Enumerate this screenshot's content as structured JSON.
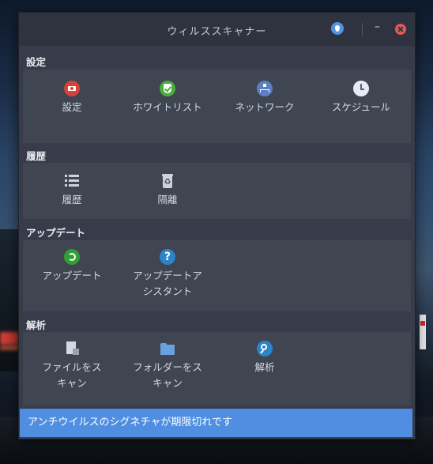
{
  "window": {
    "title": "ウィルススキャナー"
  },
  "sections": {
    "settings": {
      "header": "設定",
      "items": [
        {
          "label": "設定",
          "icon": "settings-icon"
        },
        {
          "label": "ホワイトリスト",
          "icon": "shield-check-icon"
        },
        {
          "label": "ネットワーク",
          "icon": "network-icon"
        },
        {
          "label": "スケジュール",
          "icon": "clock-icon"
        }
      ]
    },
    "history": {
      "header": "履歴",
      "items": [
        {
          "label": "履歴",
          "icon": "list-icon"
        },
        {
          "label": "隔離",
          "icon": "trash-recycle-icon"
        }
      ]
    },
    "update": {
      "header": "アップデート",
      "items": [
        {
          "label": "アップデート",
          "icon": "update-icon",
          "lines": [
            "アップデート"
          ]
        },
        {
          "label": "アップデートアシスタント",
          "icon": "help-icon",
          "lines": [
            "アップデートア",
            "シスタント"
          ]
        }
      ]
    },
    "analysis": {
      "header": "解析",
      "items": [
        {
          "label": "ファイルをスキャン",
          "icon": "file-icon",
          "lines": [
            "ファイルをス",
            "キャン"
          ]
        },
        {
          "label": "フォルダーをスキャン",
          "icon": "folder-icon",
          "lines": [
            "フォルダーをス",
            "キャン"
          ]
        },
        {
          "label": "解析",
          "icon": "magnifier-icon",
          "lines": [
            "解析"
          ]
        }
      ]
    }
  },
  "status": {
    "message": "アンチウイルスのシグネチャが期限切れです"
  },
  "colors": {
    "accent": "#5294e2",
    "status_bg": "#4f8ee0",
    "panel_bg": "#404552",
    "window_bg": "#383c4a"
  }
}
